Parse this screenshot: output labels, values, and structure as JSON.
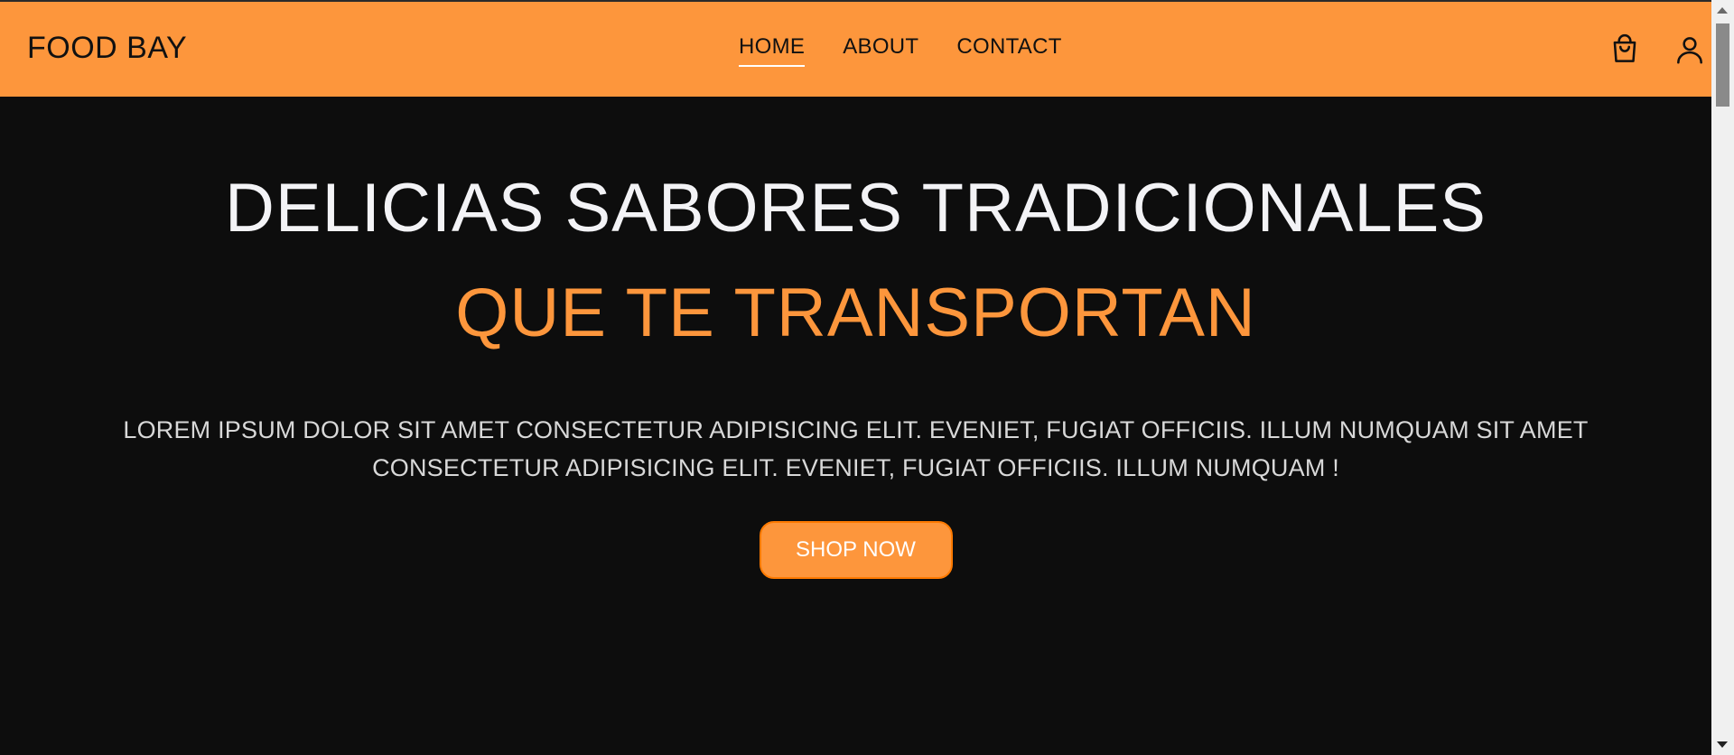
{
  "header": {
    "brand": "FOOD BAY",
    "nav": [
      "HOME",
      "ABOUT",
      "CONTACT"
    ],
    "active_nav": "HOME",
    "icons": [
      "shopping-bag-icon",
      "user-icon"
    ]
  },
  "hero": {
    "title": "DELICIAS SABORES TRADICIONALES",
    "subtitle": "QUE TE TRANSPORTAN",
    "text": "LOREM IPSUM DOLOR SIT AMET CONSECTETUR ADIPISICING ELIT. EVENIET, FUGIAT OFFICIIS. ILLUM NUMQUAM SIT AMET CONSECTETUR ADIPISICING ELIT. EVENIET, FUGIAT OFFICIIS. ILLUM NUMQUAM !",
    "cta_label": "SHOP NOW"
  },
  "colors": {
    "accent": "#fd963c",
    "background": "#0d0d0d",
    "heading": "#f3f3f6"
  }
}
